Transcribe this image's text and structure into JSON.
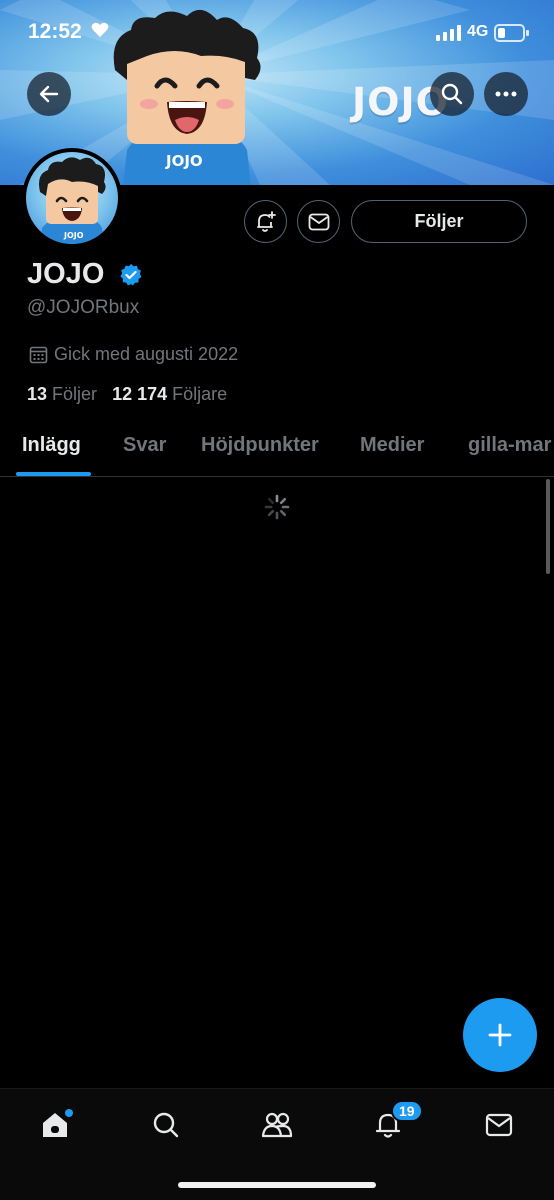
{
  "status_bar": {
    "time": "12:52",
    "network": "4G"
  },
  "banner": {
    "brand_text": "JOJO",
    "shirt_text": "JOJO"
  },
  "profile": {
    "display_name": "JOJO",
    "handle": "@JOJORbux",
    "joined": "Gick med augusti 2022",
    "following_count": "13",
    "following_label": "Följer",
    "followers_count": "12 174",
    "followers_label": "Följare",
    "follow_button_label": "Följer"
  },
  "tabs": [
    {
      "label": "Inlägg",
      "active": true
    },
    {
      "label": "Svar",
      "active": false
    },
    {
      "label": "Höjdpunkter",
      "active": false
    },
    {
      "label": "Medier",
      "active": false
    },
    {
      "label": "gilla-mar",
      "active": false
    }
  ],
  "bottom_nav": {
    "items": [
      "home-icon",
      "search-icon",
      "communities-icon",
      "bell-icon",
      "mail-icon"
    ],
    "notification_badge": "19"
  },
  "colors": {
    "accent": "#1d9bf0",
    "background": "#000000",
    "muted_text": "#71767b"
  }
}
